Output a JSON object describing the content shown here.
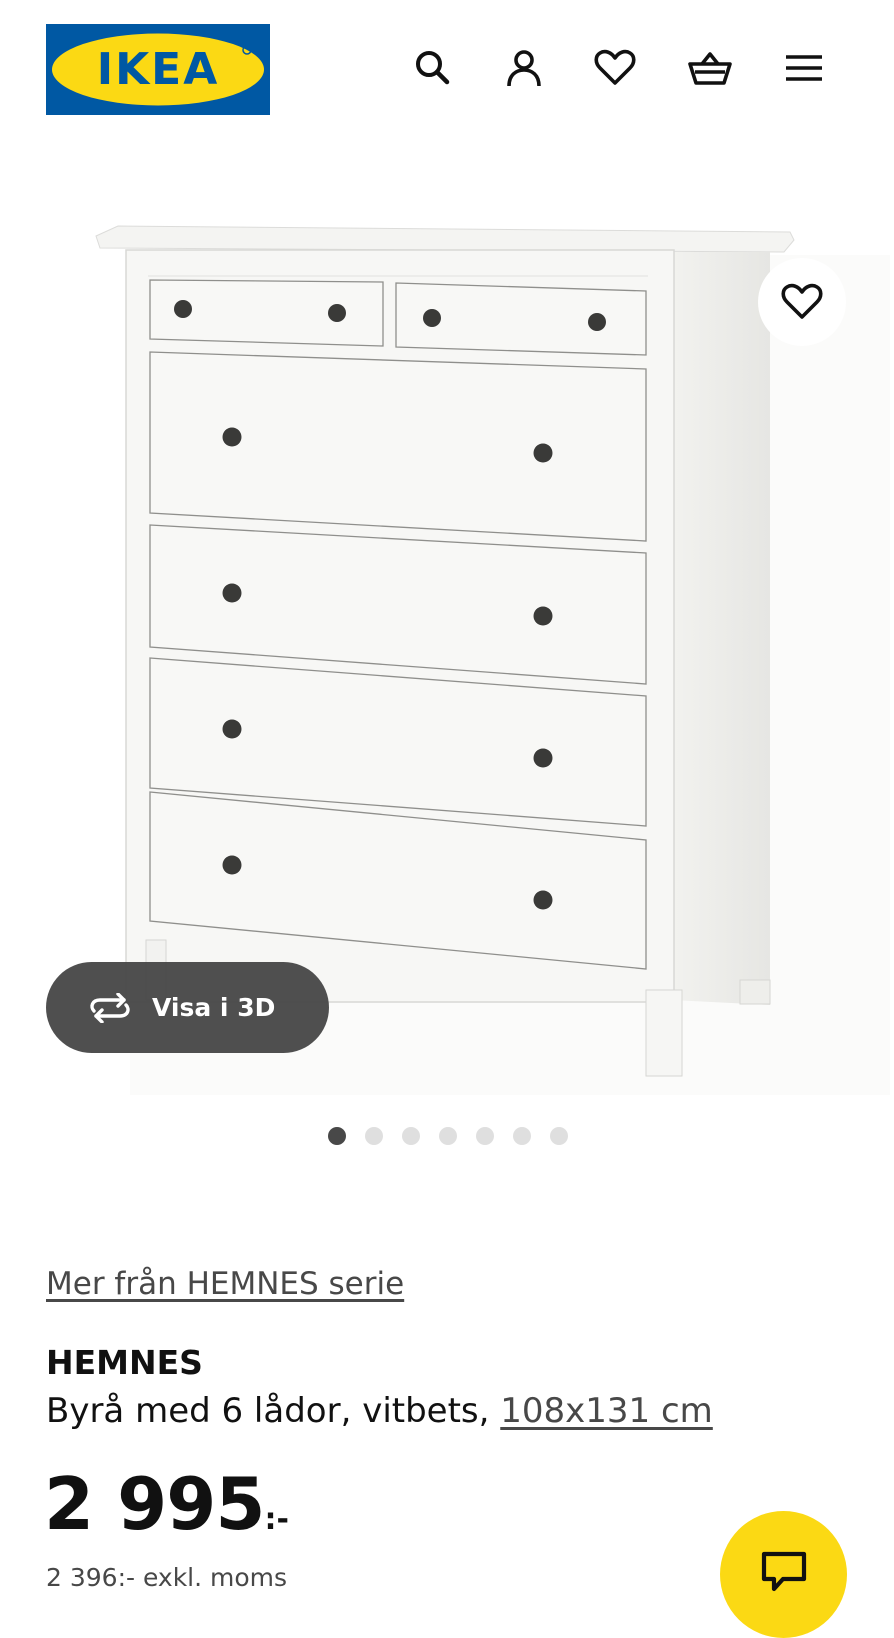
{
  "header": {
    "logo_text": "IKEA",
    "logo_colors": {
      "background": "#0058a3",
      "ellipse": "#fbd914",
      "text": "#0058a3"
    },
    "icons": [
      "search-icon",
      "user-icon",
      "heart-icon",
      "basket-icon",
      "menu-icon"
    ]
  },
  "product_image": {
    "favorite_icon": "heart-icon",
    "view_3d_label": "Visa i 3D",
    "carousel": {
      "total": 7,
      "active_index": 0
    }
  },
  "product": {
    "series_link": "Mer från HEMNES serie",
    "name": "HEMNES",
    "description": "Byrå med 6 lådor, vitbets, ",
    "dimensions": "108x131 cm",
    "price": "2 995",
    "price_suffix": ":-",
    "price_excl_vat": "2 396:- exkl. moms"
  },
  "chat": {
    "icon": "chat-icon",
    "color": "#fbd914"
  }
}
